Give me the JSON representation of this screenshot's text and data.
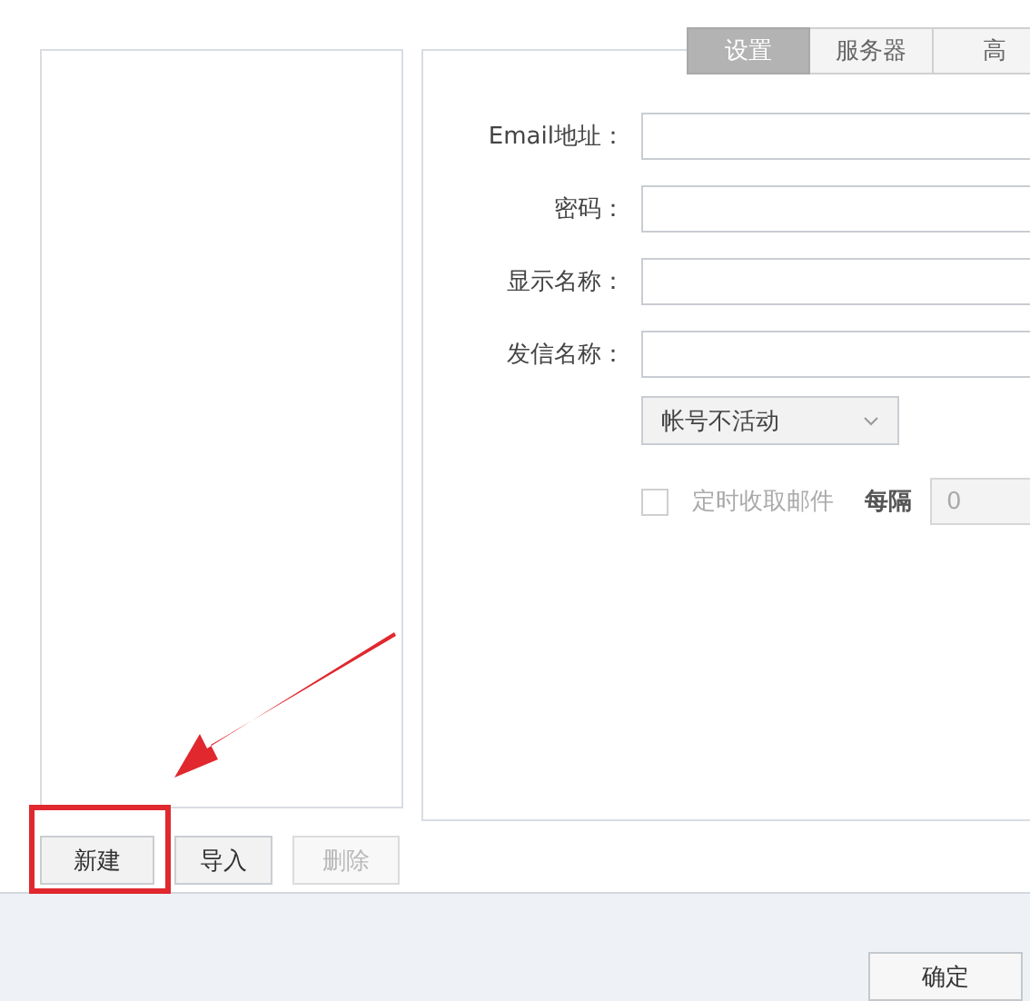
{
  "tabs": [
    {
      "label": "设置",
      "selected": true
    },
    {
      "label": "服务器",
      "selected": false
    },
    {
      "label": "高",
      "selected": false
    }
  ],
  "fields": [
    {
      "label": "Email地址："
    },
    {
      "label": "密码："
    },
    {
      "label": "显示名称："
    },
    {
      "label": "发信名称："
    }
  ],
  "account_status": {
    "value": "帐号不活动"
  },
  "auto_fetch": {
    "label": "定时收取邮件",
    "checked": false,
    "disabled": true,
    "interval_label": "每隔",
    "interval_value": "0"
  },
  "list_buttons": [
    {
      "label": "新建",
      "disabled": false
    },
    {
      "label": "导入",
      "disabled": false
    },
    {
      "label": "删除",
      "disabled": true
    }
  ],
  "footer_buttons": [
    "确定"
  ]
}
